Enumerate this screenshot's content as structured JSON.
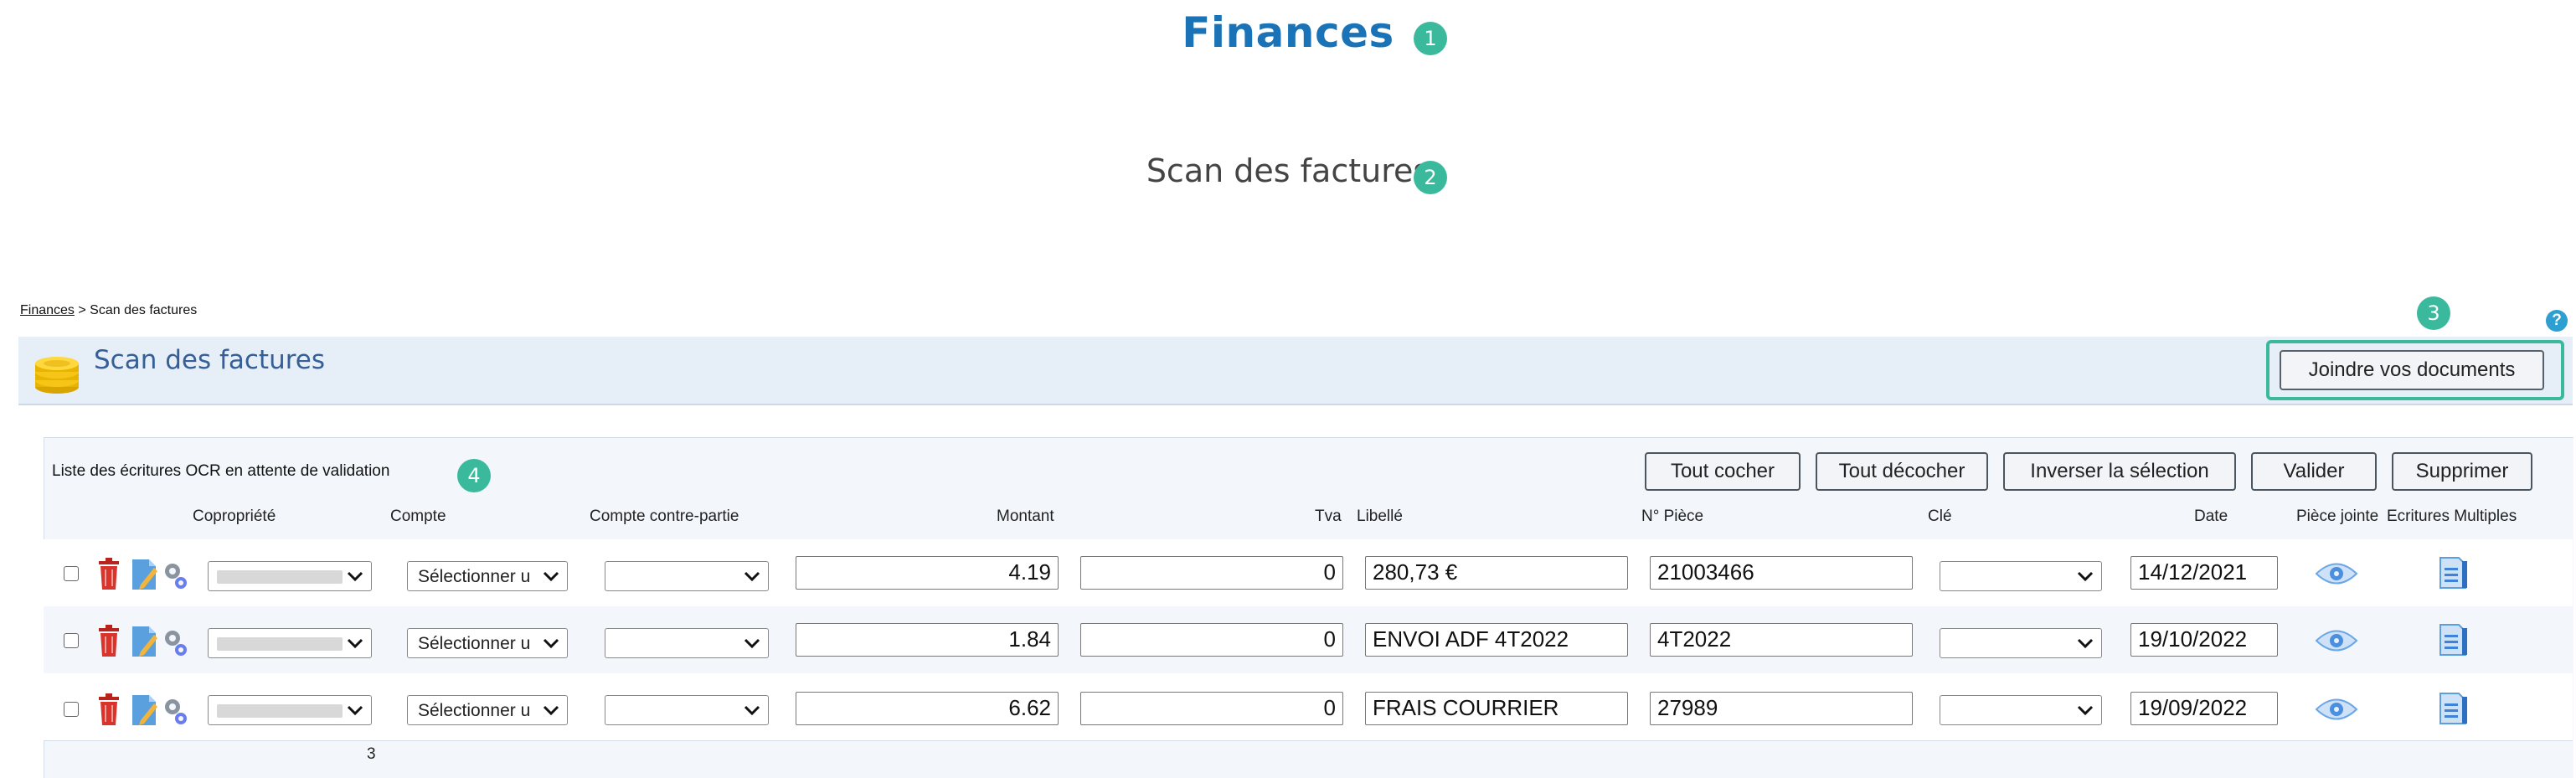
{
  "doc": {
    "title": "Finances",
    "subtitle": "Scan des factures",
    "callouts": [
      "1",
      "2",
      "3",
      "4"
    ]
  },
  "breadcrumb": {
    "link": "Finances",
    "separator": " > ",
    "current": "Scan des factures"
  },
  "header": {
    "title": "Scan des factures",
    "help_label": "?",
    "join_button": "Joindre vos documents"
  },
  "panel": {
    "title": "Liste des écritures OCR en attente de validation",
    "actions": {
      "check_all": "Tout cocher",
      "uncheck_all": "Tout décocher",
      "invert": "Inverser la sélection",
      "validate": "Valider",
      "delete": "Supprimer"
    },
    "columns": {
      "copropriete": "Copropriété",
      "compte": "Compte",
      "contre_partie": "Compte contre-partie",
      "montant": "Montant",
      "tva": "Tva",
      "libelle": "Libellé",
      "piece": "N° Pièce",
      "cle": "Clé",
      "date": "Date",
      "piece_jointe": "Pièce jointe",
      "ecritures": "Ecritures Multiples"
    },
    "rows": [
      {
        "compte": "Sélectionner u",
        "montant": "4.19",
        "tva": "0",
        "libelle": "280,73 €",
        "piece": "21003466",
        "date": "14/12/2021"
      },
      {
        "compte": "Sélectionner u",
        "montant": "1.84",
        "tva": "0",
        "libelle": "ENVOI ADF 4T2022",
        "piece": "4T2022",
        "date": "19/10/2022"
      },
      {
        "compte": "Sélectionner u",
        "montant": "6.62",
        "tva": "0",
        "libelle": "FRAIS COURRIER",
        "piece": "27989",
        "date": "19/09/2022"
      }
    ],
    "row_count": "3"
  },
  "colors": {
    "accent_green": "#3bb99c",
    "title_blue": "#1a73b6",
    "header_bg": "#e6eef7",
    "trash_red": "#d9342b"
  }
}
